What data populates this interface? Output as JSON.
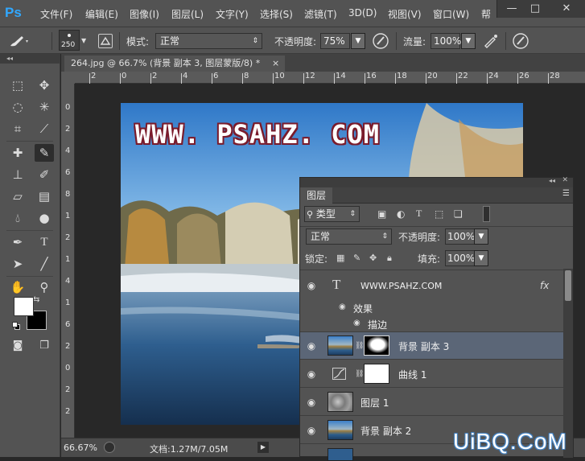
{
  "app": {
    "logo_text": "Ps"
  },
  "menu": [
    "文件(F)",
    "编辑(E)",
    "图像(I)",
    "图层(L)",
    "文字(Y)",
    "选择(S)",
    "滤镜(T)",
    "3D(D)",
    "视图(V)",
    "窗口(W)",
    "帮"
  ],
  "window_controls": {
    "minimize": "—",
    "restore": "□",
    "close": "✕"
  },
  "options": {
    "brush_size": "250",
    "mode_label": "模式:",
    "mode_value": "正常",
    "opacity_label": "不透明度:",
    "opacity_value": "75%",
    "flow_label": "流量:",
    "flow_value": "100%"
  },
  "document": {
    "tab_title": "264.jpg @ 66.7% (背景 副本 3, 图层蒙版/8) *",
    "tab_close": "×"
  },
  "ruler_top": [
    "2",
    "0",
    "2",
    "4",
    "6",
    "8",
    "10",
    "12",
    "14",
    "16",
    "18",
    "20",
    "22",
    "24",
    "26",
    "28"
  ],
  "ruler_left": [
    "0",
    "2",
    "4",
    "6",
    "8",
    "1",
    "2",
    "1",
    "4",
    "1",
    "6",
    "2",
    "0",
    "2",
    "2"
  ],
  "canvas": {
    "watermark": "WWW. PSAHZ. COM"
  },
  "status": {
    "zoom": "66.67%",
    "doc_info": "文档:1.27M/7.05M"
  },
  "layers_panel": {
    "tab": "图层",
    "filter_kind": "类型",
    "blend_mode": "正常",
    "opacity_label": "不透明度:",
    "opacity_value": "100%",
    "lock_label": "锁定:",
    "fill_label": "填充:",
    "fill_value": "100%",
    "layers": [
      {
        "name": "WWW.PSAHZ.COM",
        "type": "text"
      },
      {
        "name": "效果",
        "type": "effects"
      },
      {
        "name": "描边",
        "type": "effect-item"
      },
      {
        "name": "背景 副本 3",
        "type": "image-mask"
      },
      {
        "name": "曲线 1",
        "type": "adjustment"
      },
      {
        "name": "图层 1",
        "type": "image"
      },
      {
        "name": "背景 副本 2",
        "type": "image"
      }
    ],
    "fx_label": "fx"
  },
  "site_watermark": "UiBQ.CoM",
  "colors": {
    "accent": "#31a8ff",
    "panel": "#535353",
    "selected_row": "#5b6677"
  }
}
